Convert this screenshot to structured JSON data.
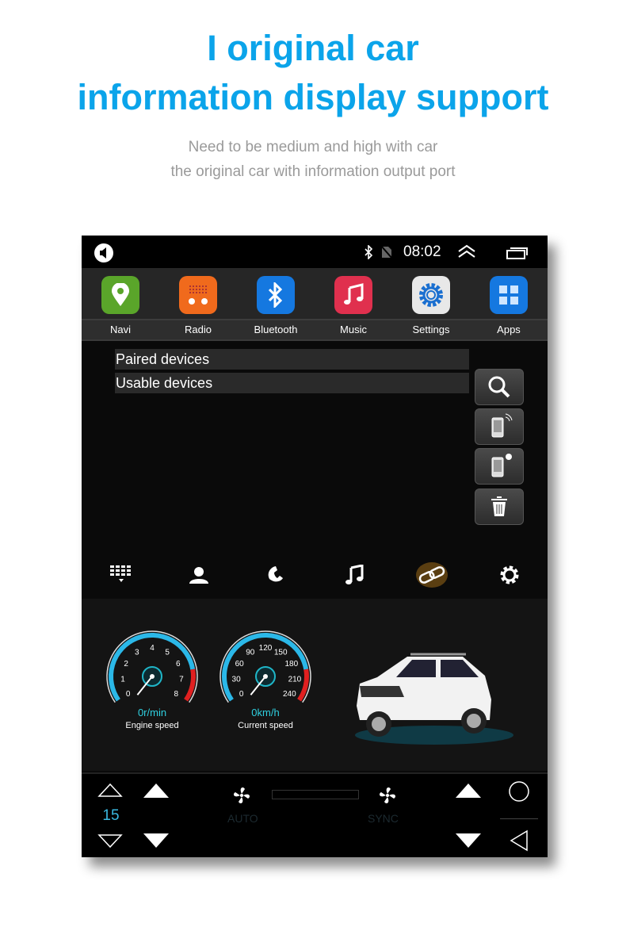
{
  "heading": {
    "line1": "I original car",
    "line2": "information display support"
  },
  "subheading": {
    "line1": "Need to be medium and high with car",
    "line2": "the original car with information output port"
  },
  "status_bar": {
    "time": "08:02",
    "icons": [
      "volume-icon",
      "bluetooth-icon",
      "no-sim-icon",
      "chevron-up-icon",
      "recent-apps-icon"
    ]
  },
  "apps": [
    {
      "label": "Navi",
      "color": "#5aa52a"
    },
    {
      "label": "Radio",
      "color": "#f06a1c"
    },
    {
      "label": "Bluetooth",
      "color": "#1578e0"
    },
    {
      "label": "Music",
      "color": "#e0304e"
    },
    {
      "label": "Settings",
      "color": "#e8e8e8"
    },
    {
      "label": "Apps",
      "color": "#1578e0"
    }
  ],
  "bluetooth": {
    "rows": [
      "Paired devices",
      "Usable devices"
    ],
    "side_buttons": [
      "search-icon",
      "phone-connect-icon",
      "phone-disconnect-icon",
      "trash-icon"
    ],
    "tabs": [
      "dialpad-icon",
      "contacts-icon",
      "call-log-icon",
      "music-icon",
      "link-icon",
      "settings-icon"
    ],
    "active_tab": 4,
    "accent": "#f0a020"
  },
  "gauges": [
    {
      "ticks": [
        "0",
        "1",
        "2",
        "3",
        "4",
        "5",
        "6",
        "7",
        "8"
      ],
      "value": "0r/min",
      "name": "Engine speed",
      "level": 0
    },
    {
      "ticks": [
        "0",
        "30",
        "60",
        "90",
        "120",
        "150",
        "180",
        "210",
        "240"
      ],
      "value": "0km/h",
      "name": "Current speed",
      "level": 0
    }
  ],
  "climate": {
    "temp": "15",
    "auto": "AUTO",
    "sync": "SYNC"
  }
}
